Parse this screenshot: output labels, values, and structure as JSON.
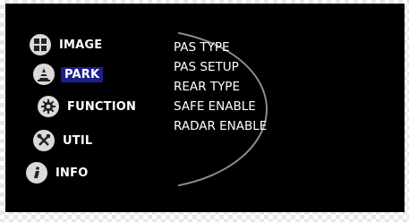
{
  "menu": {
    "items": [
      {
        "label": "IMAGE",
        "icon": "grid-icon",
        "selected": false
      },
      {
        "label": "PARK",
        "icon": "traffic-cone-icon",
        "selected": true
      },
      {
        "label": "FUNCTION",
        "icon": "gear-icon",
        "selected": false
      },
      {
        "label": "UTIL",
        "icon": "tools-icon",
        "selected": false
      },
      {
        "label": "INFO",
        "icon": "info-icon",
        "selected": false
      }
    ]
  },
  "submenu": {
    "options": [
      "PAS TYPE",
      "PAS SETUP",
      "REAR TYPE",
      "SAFE ENABLE",
      "RADAR ENABLE"
    ]
  },
  "colors": {
    "selection_highlight": "#1b1f86",
    "background": "#000000",
    "icon_circle": "#d9d9d9"
  }
}
